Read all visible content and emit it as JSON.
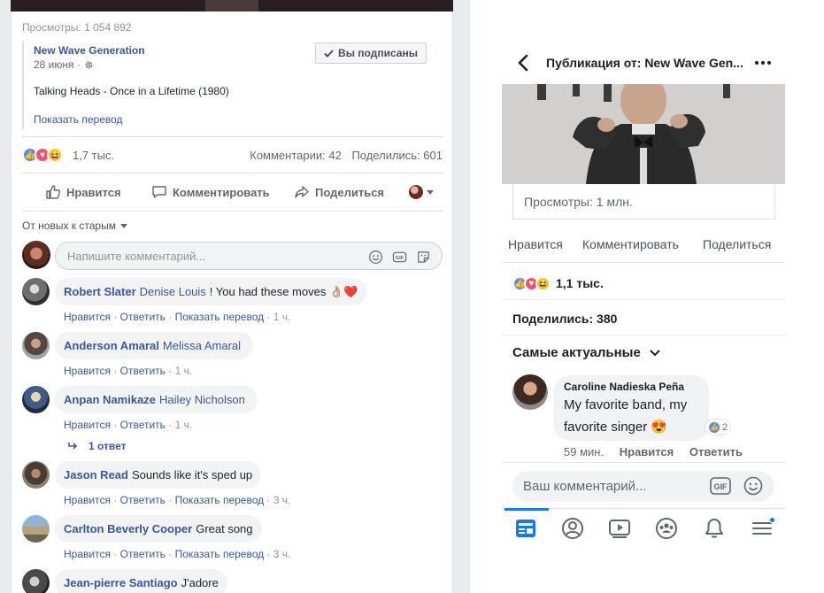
{
  "desktop": {
    "views": "Просмотры: 1 054 892",
    "page": {
      "name": "New Wave Generation",
      "date": "28 июня ·",
      "subscribed_label": "Вы подписаны"
    },
    "post_text": "Talking Heads - Once in a Lifetime (1980)",
    "translate_label": "Показать перевод",
    "reactions": {
      "count": "1,7 тыс.",
      "comments": "Комментарии: 42",
      "shares": "Поделились: 601"
    },
    "actions": {
      "like": "Нравится",
      "comment": "Комментировать",
      "share": "Поделиться"
    },
    "sort_label": "От новых к старым",
    "comment_placeholder": "Напишите комментарий...",
    "comments": [
      {
        "author": "Robert Slater",
        "tag": "Denise Louis",
        "text": "! You had these moves 👌🏼❤️",
        "time": "1 ч.",
        "translate": true
      },
      {
        "author": "Anderson Amaral",
        "tag": "Melissa Amaral",
        "text": "",
        "time": "1 ч.",
        "translate": false
      },
      {
        "author": "Anpan Namikaze",
        "tag": "Hailey Nicholson",
        "text": "",
        "time": "1 ч.",
        "translate": false
      },
      {
        "author": "Jason Read",
        "tag": "",
        "text": "Sounds like it's sped up",
        "time": "3 ч.",
        "translate": true
      },
      {
        "author": "Carlton Beverly Cooper",
        "tag": "",
        "text": "Great song",
        "time": "3 ч.",
        "translate": true
      },
      {
        "author": "Jean-pierre Santiago",
        "tag": "",
        "text": "J'adore",
        "time": "",
        "translate": false
      }
    ],
    "meta_labels": {
      "like": "Нравится",
      "reply": "Ответить",
      "translate": "Показать перевод"
    },
    "reply_count": "1 ответ"
  },
  "mobile": {
    "title": "Публикация от: New Wave Gen...",
    "views": "Просмотры: 1 млн.",
    "actions": {
      "like": "Нравится",
      "comment": "Комментировать",
      "share": "Поделиться"
    },
    "reactions_count": "1,1 тыс.",
    "shares": "Поделились: 380",
    "sort_label": "Самые актуальные",
    "comment": {
      "author": "Caroline Nadieska Peña",
      "text": "My favorite band, my favorite singer 😍",
      "likes": "2",
      "time": "59 мин.",
      "like": "Нравится",
      "reply": "Ответить"
    },
    "input_placeholder": "Ваш комментарий...",
    "gif_label": "GIF"
  },
  "colors": {
    "link_blue": "#365899",
    "fb_blue": "#1877f2",
    "bubble_gray": "#f2f3f5"
  }
}
